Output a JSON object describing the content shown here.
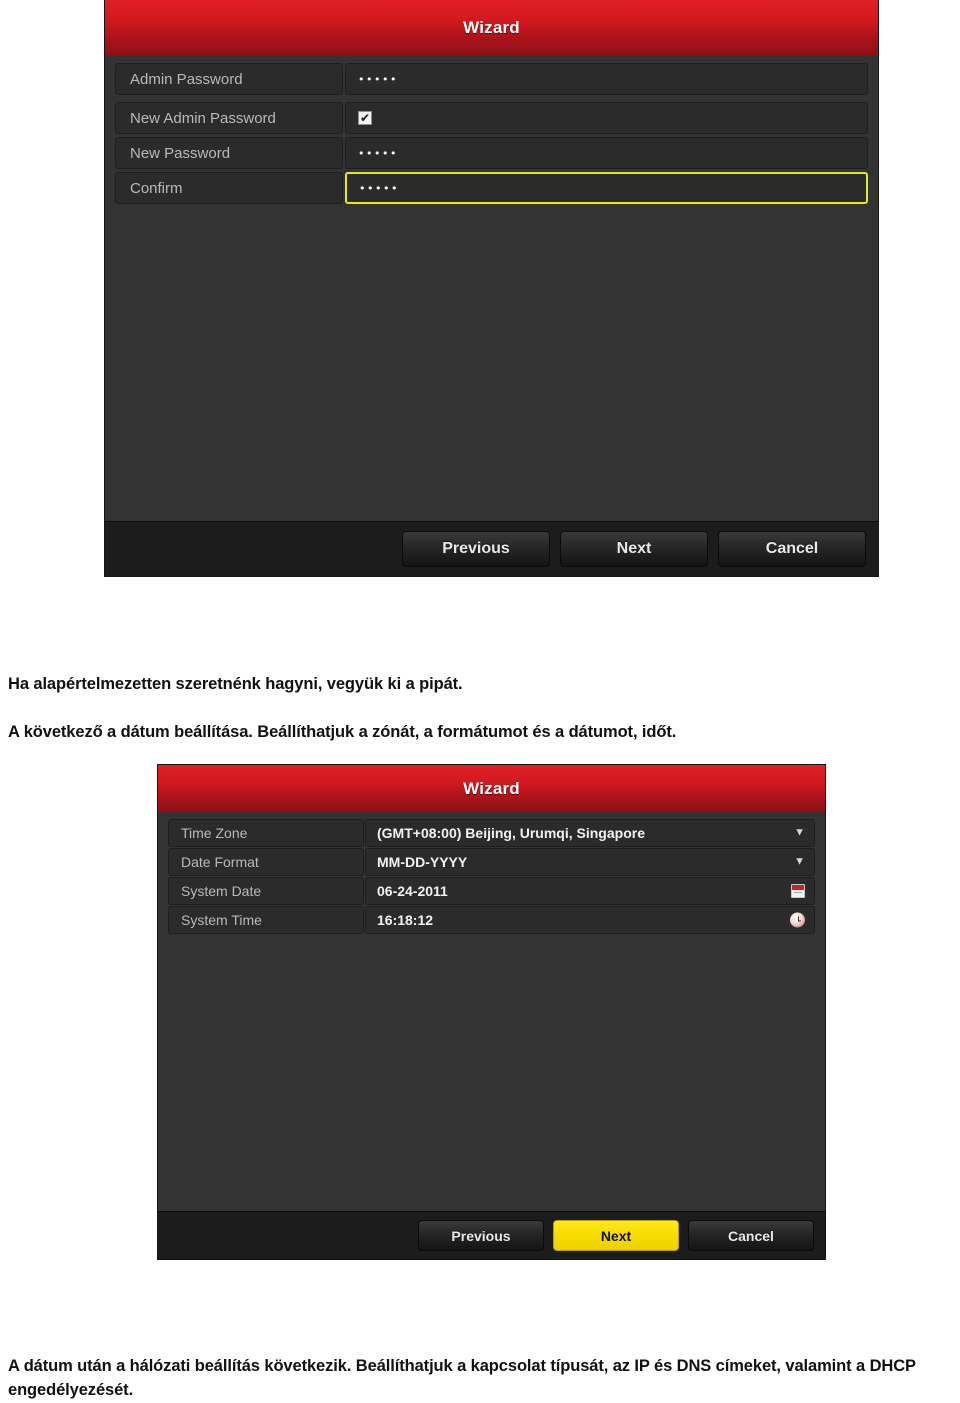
{
  "document": {
    "paragraph_1": "Ha alapértelmezetten szeretnénk hagyni, vegyük ki a pipát.",
    "paragraph_2": "A következő a dátum beállítása. Beállíthatjuk a zónát, a formátumot és a dátumot, időt.",
    "paragraph_3": "A dátum után a hálózati beállítás következik. Beállíthatjuk a kapcsolat típusát, az IP és DNS címeket, valamint a DHCP engedélyezését."
  },
  "password_dialog": {
    "title": "Wizard",
    "rows": [
      {
        "label": "Admin Password",
        "value": "•••••",
        "type": "password"
      },
      {
        "label": "New Admin Password",
        "value": "✔",
        "type": "checkbox"
      },
      {
        "label": "New Password",
        "value": "•••••",
        "type": "password"
      },
      {
        "label": "Confirm",
        "value": "•••••",
        "type": "password",
        "focused": true
      }
    ],
    "buttons": {
      "previous": "Previous",
      "next": "Next",
      "cancel": "Cancel"
    }
  },
  "datetime_dialog": {
    "title": "Wizard",
    "rows": [
      {
        "label": "Time Zone",
        "value": "(GMT+08:00) Beijing, Urumqi, Singapore",
        "accessory": "chevron-down-icon"
      },
      {
        "label": "Date Format",
        "value": "MM-DD-YYYY",
        "accessory": "chevron-down-icon"
      },
      {
        "label": "System Date",
        "value": "06-24-2011",
        "accessory": "calendar-icon"
      },
      {
        "label": "System Time",
        "value": "16:18:12",
        "accessory": "clock-icon"
      }
    ],
    "buttons": {
      "previous": "Previous",
      "next": "Next",
      "cancel": "Cancel"
    }
  },
  "colors": {
    "title_red": "#d0191e",
    "dialog_body": "#333333",
    "footer": "#1c1c1c",
    "focus_yellow": "#e8e622",
    "primary_button": "#f7dc00"
  }
}
